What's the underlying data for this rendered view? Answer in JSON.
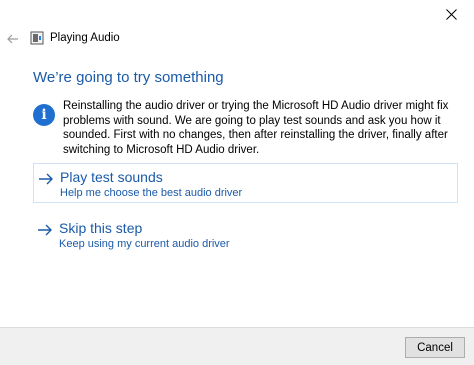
{
  "window": {
    "title": "Playing Audio",
    "close_icon": "close-icon",
    "back_icon": "back-arrow-icon",
    "app_icon": "troubleshooter-icon"
  },
  "content": {
    "heading": "We’re going to try something",
    "info_icon": "info-icon",
    "info_text": "Reinstalling the audio driver or trying the Microsoft HD Audio driver might fix problems with sound. We are going to play test sounds and ask you how it sounded. First with no changes, then after reinstalling the driver, finally after switching to Microsoft HD Audio driver.",
    "options": [
      {
        "title": "Play test sounds",
        "subtitle": "Help me choose the best audio driver",
        "icon": "arrow-right-icon"
      },
      {
        "title": "Skip this step",
        "subtitle": "Keep using my current audio driver",
        "icon": "arrow-right-icon"
      }
    ]
  },
  "footer": {
    "cancel_label": "Cancel"
  },
  "colors": {
    "accent": "#1a5aa8",
    "info_icon_bg": "#1f6fd1",
    "footer_bg": "#f0f0f0",
    "option_border": "#cfe2f7"
  }
}
